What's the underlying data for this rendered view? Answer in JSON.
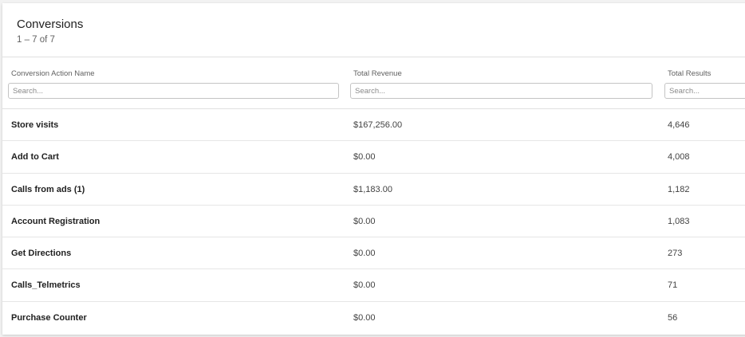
{
  "header": {
    "title": "Conversions",
    "subtitle": "1 – 7 of 7"
  },
  "columns": [
    {
      "label": "Conversion Action Name",
      "placeholder": "Search..."
    },
    {
      "label": "Total Revenue",
      "placeholder": "Search..."
    },
    {
      "label": "Total Results",
      "placeholder": "Search..."
    }
  ],
  "rows": [
    {
      "name": "Store visits",
      "revenue": "$167,256.00",
      "results": "4,646"
    },
    {
      "name": "Add to Cart",
      "revenue": "$0.00",
      "results": "4,008"
    },
    {
      "name": "Calls from ads (1)",
      "revenue": "$1,183.00",
      "results": "1,182"
    },
    {
      "name": "Account Registration",
      "revenue": "$0.00",
      "results": "1,083"
    },
    {
      "name": "Get Directions",
      "revenue": "$0.00",
      "results": "273"
    },
    {
      "name": "Calls_Telmetrics",
      "revenue": "$0.00",
      "results": "71"
    },
    {
      "name": "Purchase Counter",
      "revenue": "$0.00",
      "results": "56"
    }
  ]
}
